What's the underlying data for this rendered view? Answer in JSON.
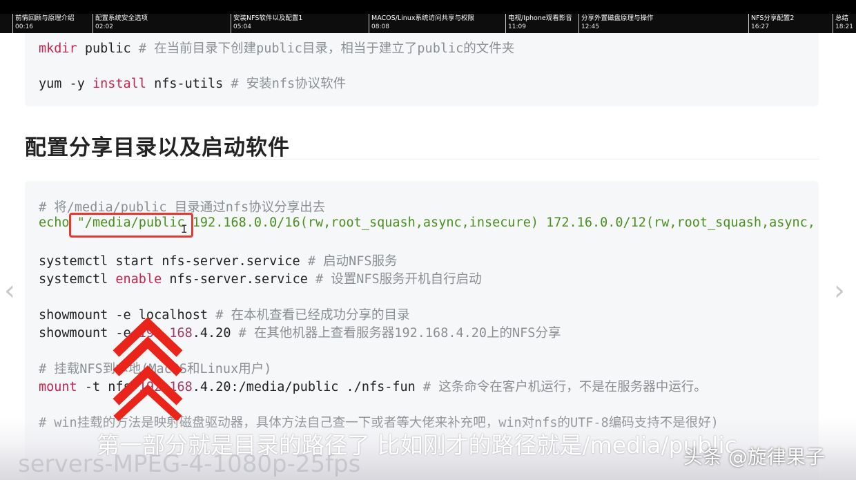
{
  "chapters": [
    {
      "title": "前情回顾与原理介绍",
      "time": "00:16"
    },
    {
      "title": "配置系统安全选项",
      "time": "02:02"
    },
    {
      "title": "安装NFS软件以及配置1",
      "time": "05:04"
    },
    {
      "title": "MACOS/Linux系统访问共享与权限",
      "time": "08:08"
    },
    {
      "title": "电视/Iphone观看影音",
      "time": "11:09"
    },
    {
      "title": "分享外置磁盘原理与操作",
      "time": "12:45"
    },
    {
      "title": "NFS分享配置2",
      "time": "16:27"
    },
    {
      "title": "总结",
      "time": "18:21"
    }
  ],
  "top_block": {
    "line1": {
      "cmd": "mkdir",
      "rest": " public ",
      "comment": "# 在当前目录下创建public目录，相当于建立了public的文件夹"
    },
    "line2": {
      "cmd": "yum -y ",
      "kw": "install",
      "rest": " nfs-utils ",
      "comment": "# 安装nfs协议软件"
    }
  },
  "heading": "配置分享目录以及启动软件",
  "main_block": {
    "l1": "# 将/media/public 目录通过nfs协议分享出去",
    "l2_a": "echo ",
    "l2_b": "\"/media/public",
    "l2_c": " 192.168.0.0/16(rw,root_squash,async,insecure) 172.16.0.0/12(rw,root_squash,async,",
    "l3_a": "systemctl start nfs-server.service ",
    "l3_b": "# 启动NFS服务",
    "l4_a": "systemctl ",
    "l4_b": "enable",
    "l4_c": " nfs-server.service ",
    "l4_d": "# 设置NFS服务开机自行启动",
    "l5_a": "showmount -e localhost ",
    "l5_b": "# 在本机查看已经成功分享的目录",
    "l6_a": "showmount -e ",
    "l6_b": "192.168",
    "l6_c": ".4.20 ",
    "l6_d": "# 在其他机器上查看服务器192.168.4.20上的NFS分享",
    "l7": "# 挂载NFS到本地(MacOS和Linux用户)",
    "l8_a": "mount",
    "l8_b": " -t nfs ",
    "l8_c": "192.168",
    "l8_d": ".4.20:/media/public ./nfs-fun ",
    "l8_e": "# 这条命令在客户机运行，不是在服务器中运行。",
    "l9": "# win挂载的方法是映射磁盘驱动器，具体方法自己查一下或者等大佬来补充吧，win对nfs的UTF-8编码支持不是很好)"
  },
  "subtitle": "第一部分就是目录的路径了 比如刚才的路径就是/media/public",
  "watermark": "头条 @旋律果子",
  "ghost_text": "servers-MPEG-4-1080p-25fps",
  "nav": {
    "left": "‹",
    "right": "›"
  },
  "colors": {
    "accent_red": "#e5392f",
    "progress_blue": "#3a73e4"
  }
}
